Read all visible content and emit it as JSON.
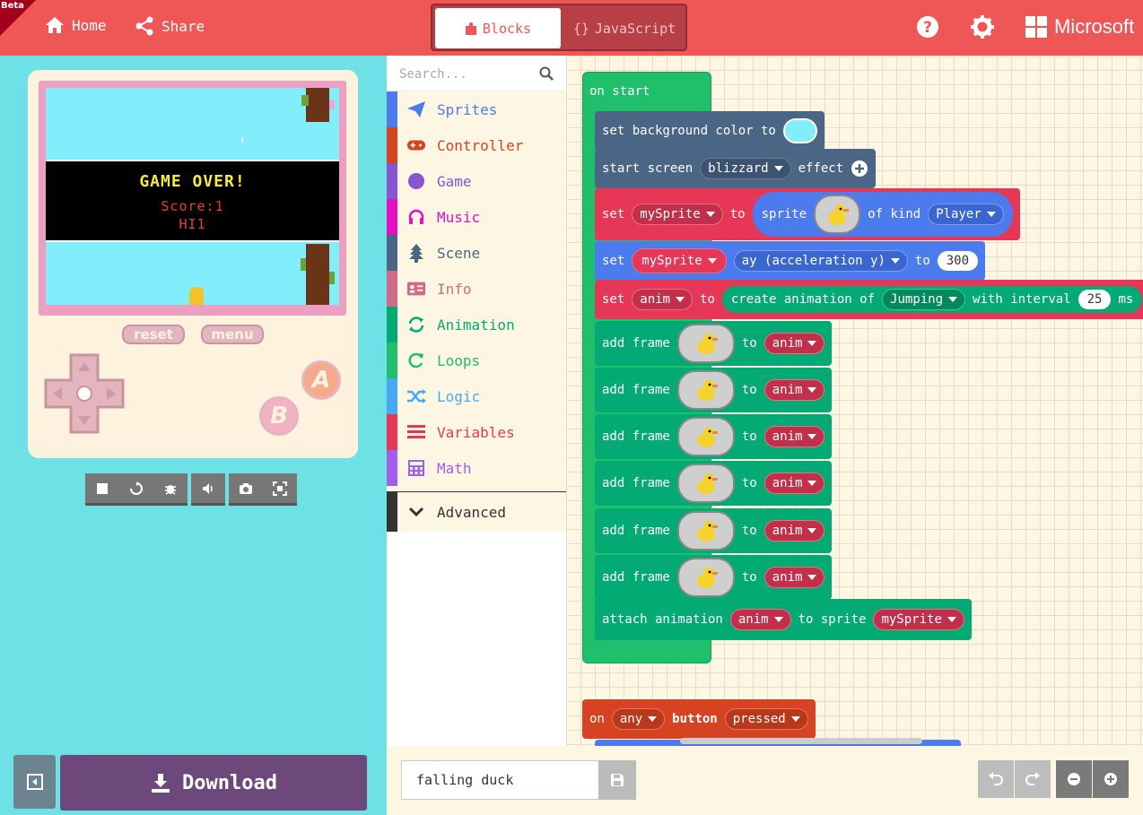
{
  "header": {
    "badge": "Beta",
    "home_label": "Home",
    "share_label": "Share",
    "tabs": [
      {
        "label": "Blocks"
      },
      {
        "label": "JavaScript"
      }
    ],
    "brand": "Microsoft",
    "colors": {
      "bar": "#ef5756",
      "active_tab_text": "#ef5756"
    }
  },
  "simulator": {
    "game_over_title": "GAME OVER!",
    "score_text": "Score:1",
    "hi_text": "HI1",
    "reset_label": "reset",
    "menu_label": "menu",
    "a_label": "A",
    "b_label": "B",
    "toolbar_icons": [
      "stop-icon",
      "restart-icon",
      "debug-icon",
      "sound-icon",
      "screenshot-icon",
      "fullscreen-icon"
    ]
  },
  "download": {
    "label": "Download"
  },
  "toolbox": {
    "search_placeholder": "Search...",
    "categories": [
      {
        "label": "Sprites",
        "color": "#4b7bec"
      },
      {
        "label": "Controller",
        "color": "#d54322"
      },
      {
        "label": "Game",
        "color": "#8854d0"
      },
      {
        "label": "Music",
        "color": "#e30fc0"
      },
      {
        "label": "Scene",
        "color": "#4b6584"
      },
      {
        "label": "Info",
        "color": "#cf6a87"
      },
      {
        "label": "Animation",
        "color": "#03aa74"
      },
      {
        "label": "Loops",
        "color": "#20bf6b"
      },
      {
        "label": "Logic",
        "color": "#45aaf2"
      },
      {
        "label": "Variables",
        "color": "#e63757"
      },
      {
        "label": "Math",
        "color": "#a55eea"
      }
    ],
    "advanced_label": "Advanced"
  },
  "workspace": {
    "on_start": "on start",
    "set_bg": {
      "text": "set background color to"
    },
    "start_screen": {
      "prefix": "start screen",
      "effect_value": "blizzard",
      "suffix": "effect"
    },
    "set_sprite": {
      "set": "set",
      "var": "mySprite",
      "to": "to",
      "sprite": "sprite",
      "of_kind": "of kind",
      "kind": "Player"
    },
    "set_ay": {
      "set": "set",
      "var": "mySprite",
      "prop": "ay (acceleration y)",
      "to": "to",
      "value": "300"
    },
    "set_anim": {
      "set": "set",
      "var": "anim",
      "to": "to",
      "create": "create animation of",
      "action": "Jumping",
      "with": "with interval",
      "interval": "25",
      "unit": "ms"
    },
    "add_frame": {
      "label": "add frame",
      "to": "to",
      "var": "anim",
      "count": 6
    },
    "attach": {
      "label": "attach animation",
      "anim": "anim",
      "to_sprite": "to sprite",
      "sprite": "mySprite"
    },
    "on_button": {
      "on": "on",
      "which": "any",
      "button": "button",
      "event": "pressed"
    }
  },
  "project": {
    "name": "falling duck"
  }
}
